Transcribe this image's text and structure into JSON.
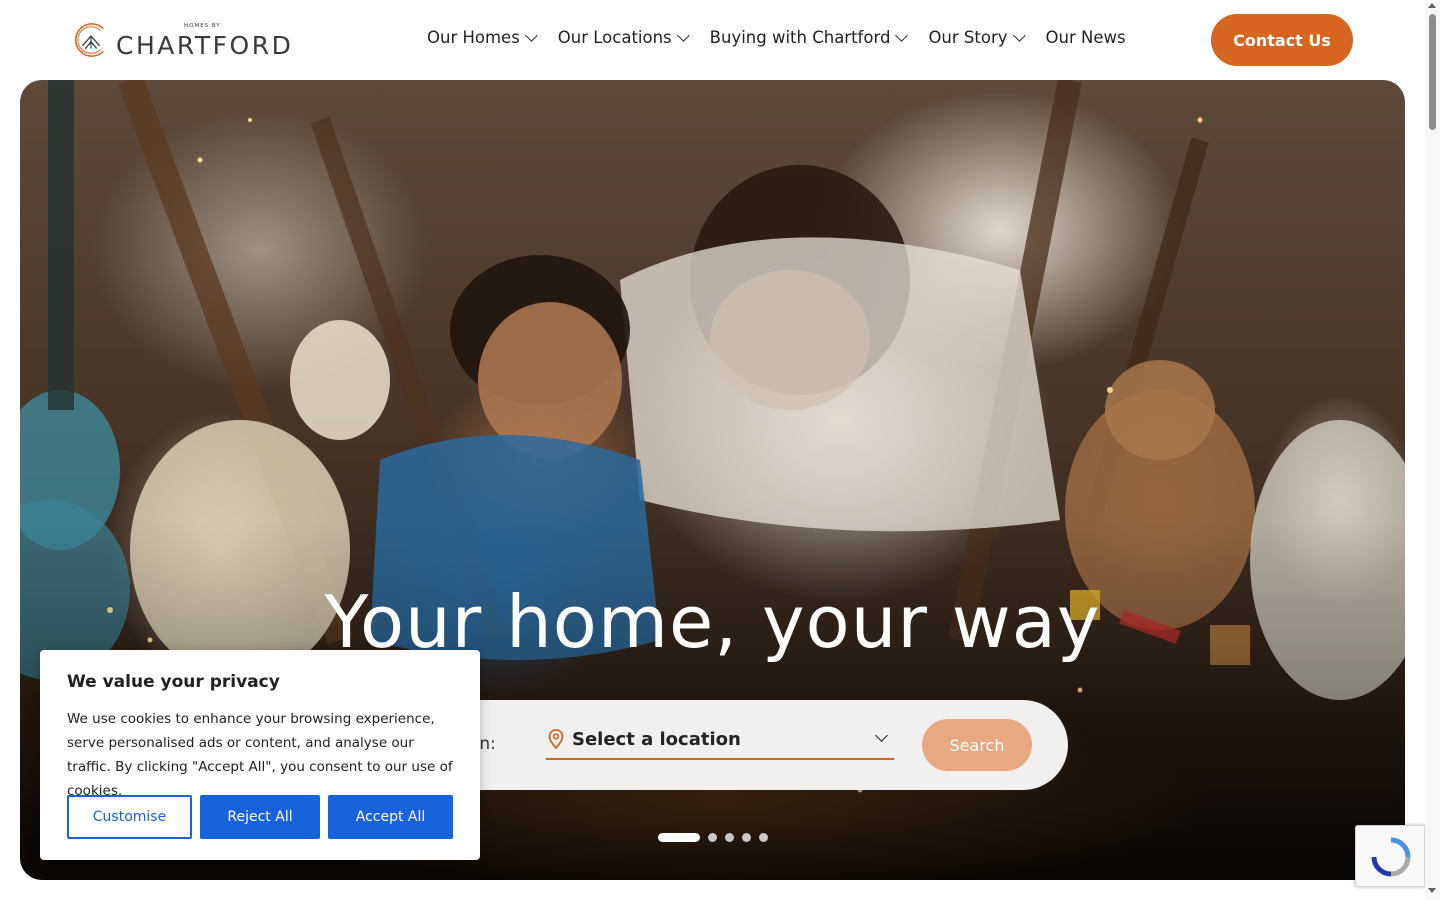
{
  "header": {
    "logo_small_text": "HOMES BY",
    "logo_brand": "CHARTFORD",
    "nav": [
      {
        "label": "Our Homes",
        "has_dropdown": true
      },
      {
        "label": "Our Locations",
        "has_dropdown": true
      },
      {
        "label": "Buying with Chartford",
        "has_dropdown": true
      },
      {
        "label": "Our Story",
        "has_dropdown": true
      },
      {
        "label": "Our News",
        "has_dropdown": false
      }
    ],
    "contact_label": "Contact Us"
  },
  "hero": {
    "title": "Your home, your way",
    "search": {
      "label_partial": "ne in:",
      "location_placeholder": "Select a location",
      "search_button": "Search"
    },
    "carousel": {
      "slide_count": 5,
      "active_index": 0
    }
  },
  "cookie_banner": {
    "title": "We value your privacy",
    "text": "We use cookies to enhance your browsing experience, serve personalised ads or content, and analyse our traffic. By clicking \"Accept All\", you consent to our use of cookies.",
    "customise_label": "Customise",
    "reject_label": "Reject All",
    "accept_label": "Accept All"
  },
  "colors": {
    "brand_orange": "#d7641f",
    "search_button_tint": "#e8a882",
    "cookie_blue": "#1863dc"
  },
  "icons": {
    "location": "map-pin-icon",
    "dropdown": "chevron-down-icon",
    "recaptcha": "recaptcha-icon"
  }
}
